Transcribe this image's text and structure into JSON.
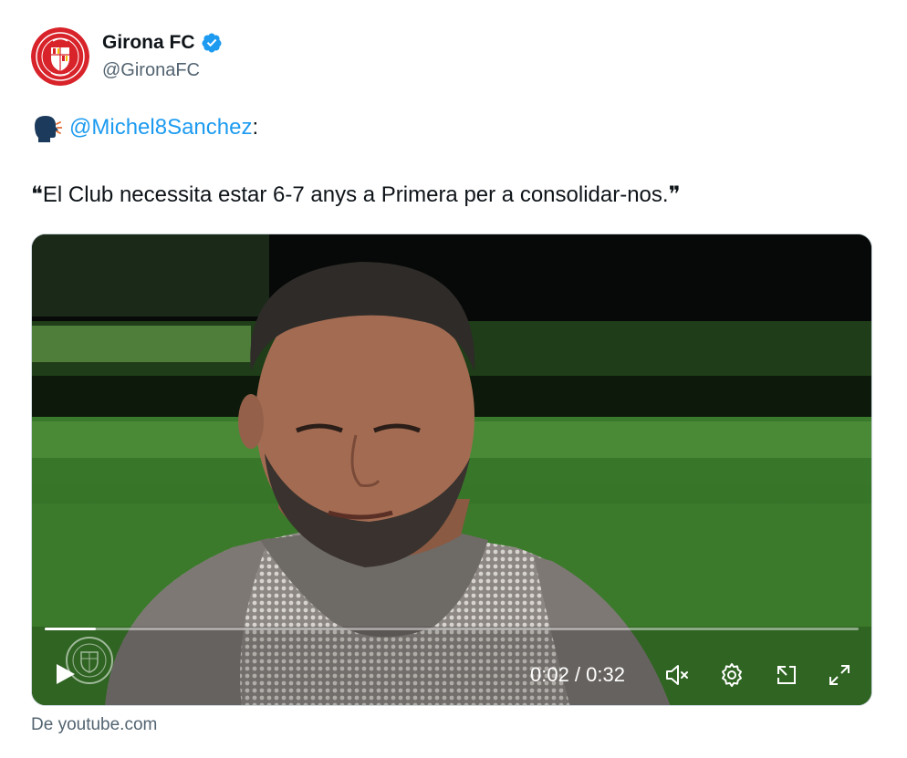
{
  "author": {
    "display_name": "Girona FC",
    "handle": "@GironaFC",
    "verified_icon": "verified-badge-icon",
    "avatar_icon": "girona-fc-crest"
  },
  "tweet": {
    "emoji_icon": "speaking-head-icon",
    "mention": "@Michel8Sanchez",
    "mention_suffix": " :",
    "quote": "❝El Club necessita estar 6-7 anys a Primera per a consolidar-nos.❞"
  },
  "video": {
    "progress": 0.0625,
    "time": "0:02 / 0:32",
    "icons": {
      "play": "play-icon",
      "mute": "volume-muted-icon",
      "settings": "settings-gear-icon",
      "pip": "picture-in-picture-icon",
      "fullscreen": "fullscreen-icon",
      "watermark": "girona-watermark"
    }
  },
  "source_text": "De youtube.com",
  "colors": {
    "link": "#1d9bf0",
    "secondary_text": "#536471",
    "verified": "#1d9bf0",
    "brand_red": "#d8232a"
  }
}
